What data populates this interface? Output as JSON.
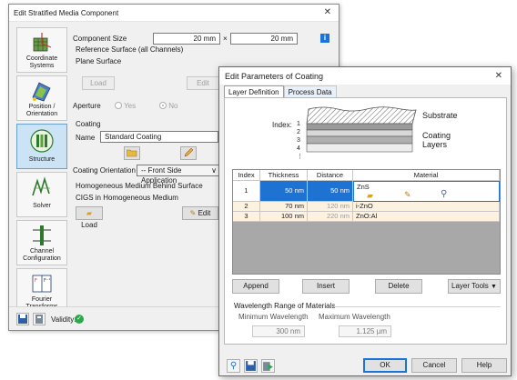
{
  "back_window": {
    "title": "Edit Stratified Media Component",
    "sidebar": [
      {
        "label_1": "Coordinate",
        "label_2": "Systems"
      },
      {
        "label_1": "Position /",
        "label_2": "Orientation"
      },
      {
        "label_1": "Structure",
        "label_2": ""
      },
      {
        "label_1": "Solver",
        "label_2": ""
      },
      {
        "label_1": "Channel",
        "label_2": "Configuration"
      },
      {
        "label_1": "Fourier",
        "label_2": "Transforms"
      }
    ],
    "component_size_label": "Component Size",
    "size_x": "20 mm",
    "size_times": "×",
    "size_y": "20 mm",
    "reference_surface_title": "Reference Surface (all Channels)",
    "reference_surface_value": "Plane Surface",
    "reference_load_label": "Load",
    "reference_edit_label": "Edit",
    "aperture_label": "Aperture",
    "aperture_yes": "Yes",
    "aperture_no": "No",
    "coating_title": "Coating",
    "coating_name_label": "Name",
    "coating_name_value": "Standard Coating",
    "coating_orientation_label": "Coating Orientation",
    "coating_orientation_value": "-- Front Side Application",
    "homogeneous_title": "Homogeneous Medium Behind Surface",
    "homogeneous_value": "CIGS in Homogeneous Medium",
    "hom_load_label": "Load",
    "hom_edit_label": "Edit",
    "validity_label": "Validity:"
  },
  "front_window": {
    "title": "Edit Parameters of Coating",
    "tabs": [
      "Layer Definition",
      "Process Data"
    ],
    "diagram": {
      "index_label": "Index:",
      "indices": [
        "1",
        "2",
        "3",
        "4",
        "⋮"
      ],
      "substrate_label": "Substrate",
      "coating_label_1": "Coating",
      "coating_label_2": "Layers"
    },
    "table": {
      "headers": [
        "Index",
        "Thickness",
        "Distance",
        "Material"
      ],
      "rows": [
        {
          "index": "1",
          "thickness": "50 nm",
          "distance": "50 nm",
          "material": "ZnS"
        },
        {
          "index": "2",
          "thickness": "70 nm",
          "distance": "120 nm",
          "material": "i-ZnO"
        },
        {
          "index": "3",
          "thickness": "100 nm",
          "distance": "220 nm",
          "material": "ZnO:Al"
        }
      ]
    },
    "buttons": {
      "append": "Append",
      "insert": "Insert",
      "delete": "Delete",
      "layer_tools": "Layer Tools"
    },
    "wavelength": {
      "title": "Wavelength Range of Materials",
      "min_label": "Minimum Wavelength",
      "max_label": "Maximum Wavelength",
      "min_value": "300 nm",
      "max_value": "1.125 µm"
    },
    "footer": {
      "ok": "OK",
      "cancel": "Cancel",
      "help": "Help"
    }
  },
  "colors": {
    "selection_blue": "#1e73d2",
    "row_tint": "#fdf1df",
    "active_sidebar": "#cce3f6",
    "validity_green": "#2aa84a"
  }
}
